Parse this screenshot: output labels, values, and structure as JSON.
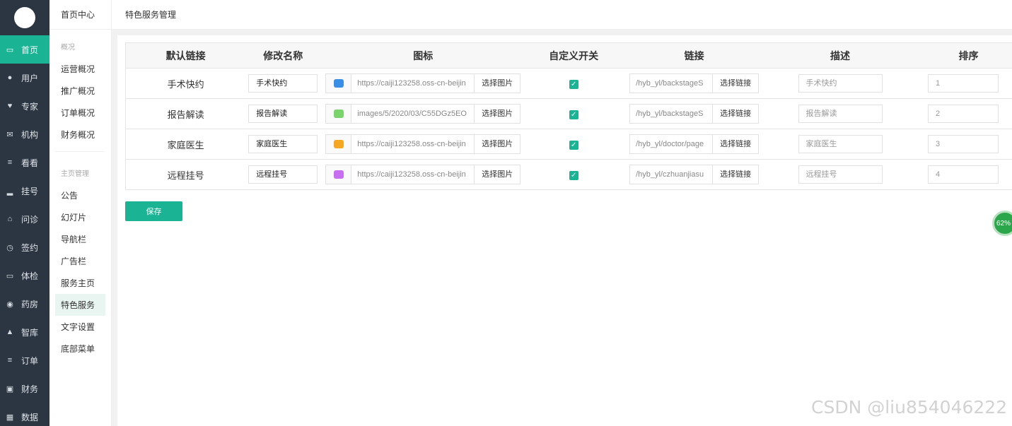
{
  "main_nav": [
    {
      "label": "首页",
      "icon": "monitor-icon",
      "active": true
    },
    {
      "label": "用户",
      "icon": "user-icon"
    },
    {
      "label": "专家",
      "icon": "heart-icon"
    },
    {
      "label": "机构",
      "icon": "mail-icon"
    },
    {
      "label": "看看",
      "icon": "list-icon"
    },
    {
      "label": "挂号",
      "icon": "signal-icon"
    },
    {
      "label": "问诊",
      "icon": "home-icon"
    },
    {
      "label": "签约",
      "icon": "clock-icon"
    },
    {
      "label": "体检",
      "icon": "inbox-icon"
    },
    {
      "label": "药房",
      "icon": "play-circle-icon"
    },
    {
      "label": "智库",
      "icon": "lock-icon"
    },
    {
      "label": "订单",
      "icon": "list-icon"
    },
    {
      "label": "财务",
      "icon": "card-icon"
    },
    {
      "label": "数据",
      "icon": "grid-icon"
    }
  ],
  "sub_nav": {
    "title": "首页中心",
    "group1": "概况",
    "group1_items": [
      "运营概况",
      "推广概况",
      "订单概况",
      "财务概况"
    ],
    "group2": "主页管理",
    "group2_items": [
      "公告",
      "幻灯片",
      "导航栏",
      "广告栏",
      "服务主页",
      "特色服务",
      "文字设置",
      "底部菜单"
    ],
    "active": "特色服务"
  },
  "topbar": {
    "title": "特色服务管理"
  },
  "table": {
    "headers": [
      "默认链接",
      "修改名称",
      "图标",
      "自定义开关",
      "链接",
      "描述",
      "排序"
    ],
    "select_image_label": "选择图片",
    "select_link_label": "选择链接",
    "rows": [
      {
        "default": "手术快约",
        "name": "手术快约",
        "icon_color": "#3a8ee6",
        "icon_url": "https://caiji123258.oss-cn-beijin",
        "enabled": true,
        "link": "/hyb_yl/backstageS",
        "desc": "手术快约",
        "sort": "1"
      },
      {
        "default": "报告解读",
        "name": "报告解读",
        "icon_color": "#7ad36b",
        "icon_url": "images/5/2020/03/C55DGz5EO",
        "enabled": true,
        "link": "/hyb_yl/backstageS",
        "desc": "报告解读",
        "sort": "2"
      },
      {
        "default": "家庭医生",
        "name": "家庭医生",
        "icon_color": "#f5a623",
        "icon_url": "https://caiji123258.oss-cn-beijin",
        "enabled": true,
        "link": "/hyb_yl/doctor/page",
        "desc": "家庭医生",
        "sort": "3"
      },
      {
        "default": "远程挂号",
        "name": "远程挂号",
        "icon_color": "#c86ef0",
        "icon_url": "https://caiji123258.oss-cn-beijin",
        "enabled": true,
        "link": "/hyb_yl/czhuanjiasu",
        "desc": "远程挂号",
        "sort": "4"
      }
    ]
  },
  "save_label": "保存",
  "badge_text": "62%",
  "watermark": "CSDN @liu854046222",
  "accent_color": "#1ab394"
}
